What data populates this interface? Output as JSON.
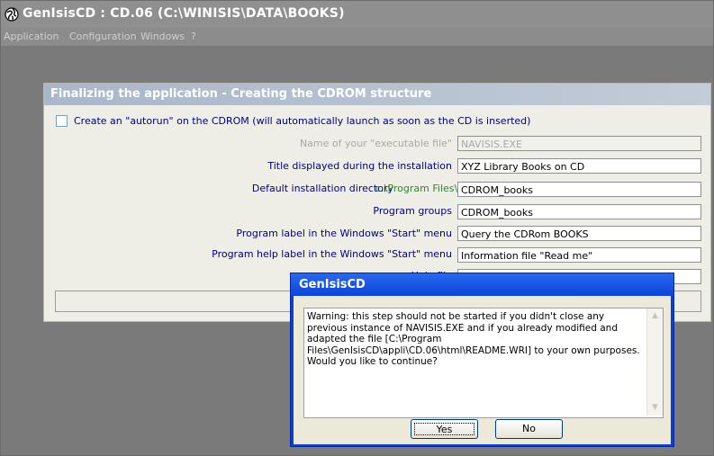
{
  "window": {
    "title": "GenIsisCD : CD.06 (C:\\WINISIS\\DATA\\BOOKS)",
    "icon": "globe-icon"
  },
  "menubar": {
    "items": [
      {
        "label": "Application"
      },
      {
        "label": "Configuration"
      },
      {
        "label": "Windows"
      },
      {
        "label": "?"
      }
    ]
  },
  "form": {
    "title": "Finalizing the application - Creating the CDROM structure",
    "autorun_label": "Create an \"autorun\" on the CDROM (will automatically launch as soon as the CD is inserted)",
    "autorun_checked": false,
    "fields": [
      {
        "label": "Name of your \"executable file\"",
        "value": "NAVISIS.EXE",
        "disabled": true
      },
      {
        "label": "Title displayed during the installation",
        "value": "XYZ Library Books on CD"
      },
      {
        "label": "Default installation directory",
        "prefix": "c:\\Program Files\\",
        "value": "CDROM_books"
      },
      {
        "label": "Program groups",
        "value": "CDROM_books"
      },
      {
        "label": "Program label in the Windows \"Start\" menu",
        "value": "Query the CDRom BOOKS"
      },
      {
        "label": "Program help label in the Windows \"Start\" menu",
        "value": "Information file \"Read me\""
      },
      {
        "label": "Help file",
        "value": ""
      }
    ]
  },
  "dialog": {
    "title": "GenIsisCD",
    "message": "Warning: this step should not be started if you didn't close any previous instance of NAVISIS.EXE and if you already modified and adapted the file [C:\\Program Files\\GenIsisCD\\appli\\CD.06\\html\\README.WRI] to your own purposes. Would you like to continue?",
    "yes_label": "Yes",
    "no_label": "No"
  }
}
